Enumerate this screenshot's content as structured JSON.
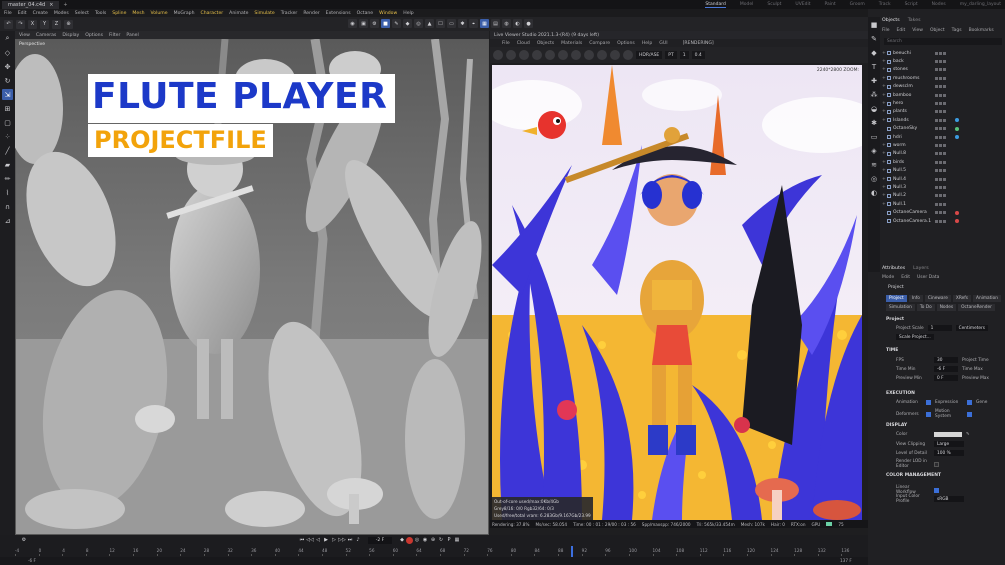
{
  "window": {
    "tab_title": "master_04.c4d",
    "close": "×",
    "add_tab": "+"
  },
  "layouts": [
    "Standard",
    "Model",
    "Sculpt",
    "UVEdit",
    "Paint",
    "Groom",
    "Track",
    "Script",
    "Nodes",
    "my_darling_layout"
  ],
  "menubar": [
    "File",
    "Edit",
    "Create",
    "Modes",
    "Select",
    "Tools",
    "Spline",
    "Mesh",
    "Volume",
    "MoGraph",
    "Character",
    "Animate",
    "Simulate",
    "Tracker",
    "Render",
    "Extensions",
    "Octane",
    "Window",
    "Help"
  ],
  "viewport": {
    "menu": [
      "View",
      "Cameras",
      "Display",
      "Options",
      "Filter",
      "Panel"
    ],
    "label": "Perspective"
  },
  "overlay": {
    "title": "FLUTE PLAYER",
    "subtitle": "PROJECTFILE"
  },
  "live_viewer": {
    "title": "Live Viewer Studio 2021.1.3-(R4) (9 days left)",
    "menu": [
      "File",
      "Cloud",
      "Objects",
      "Materials",
      "Compare",
      "Options",
      "Help",
      "GUI"
    ],
    "status": "[RENDERING]",
    "display_mode": "HDR/ASE",
    "pt_field": "PT",
    "value_field": "1",
    "gamma_field": "0.4",
    "resolution": "2240*2800 ZOOM:",
    "stats": [
      "Out-of-core used/max:0Kb/4Gb",
      "Grey8/16: 0/0      Rgb32/64: 0/3",
      "Used/free/total vram: 6.283Gb/9.167Gb/23.99",
      "Rendering: 37.8%   Ms/sec: 58.054   Time: 00 : 01 : 29/00 : 03 : 56   Spp/maxspp: 746/2000   Tri: 565k/33.454m   Mesh: 107k   Hair: 0   RTX:on   GPU: 75"
    ],
    "status_segments": [
      "Rendering: 37.8%",
      "Ms/sec: 58.054",
      "Time: 00 : 01 : 29/00 : 03 : 56",
      "Spp/maxspp: 746/2000",
      "Tri: 565k/33.454m",
      "Mesh: 107k",
      "Hair: 0",
      "RTX:on",
      "GPU",
      "75"
    ]
  },
  "timeline": {
    "current_frame": "-2 F",
    "ruler_ticks": [
      "-4",
      "0",
      "4",
      "8",
      "12",
      "16",
      "20",
      "24",
      "28",
      "32",
      "36",
      "40",
      "44",
      "48",
      "52",
      "56",
      "60",
      "64",
      "68",
      "72",
      "76",
      "80",
      "84",
      "88",
      "92",
      "96",
      "100",
      "104",
      "108",
      "112",
      "116",
      "120",
      "124",
      "128",
      "132",
      "136"
    ],
    "start": "-6 F",
    "end": "137 F"
  },
  "objects_panel": {
    "tabs": [
      "Objects",
      "Takes"
    ],
    "menu": [
      "File",
      "Edit",
      "View",
      "Object",
      "Tags",
      "Bookmarks"
    ],
    "search_placeholder": "Search",
    "items": [
      {
        "name": "beeuchi",
        "expand": "+"
      },
      {
        "name": "back",
        "expand": "+"
      },
      {
        "name": "stones",
        "expand": "+"
      },
      {
        "name": "mushrooms",
        "expand": "+"
      },
      {
        "name": "dewsclm",
        "expand": "+"
      },
      {
        "name": "bamboo",
        "expand": "+"
      },
      {
        "name": "hero",
        "expand": "+"
      },
      {
        "name": "plants",
        "expand": "+"
      },
      {
        "name": "Islands",
        "expand": "+"
      },
      {
        "name": "OctaneSky",
        "expand": ""
      },
      {
        "name": "hdri",
        "expand": ""
      },
      {
        "name": "worm",
        "expand": "+"
      },
      {
        "name": "Null.8",
        "expand": "+"
      },
      {
        "name": "birds",
        "expand": "+"
      },
      {
        "name": "Null.5",
        "expand": "+"
      },
      {
        "name": "Null.4",
        "expand": "+"
      },
      {
        "name": "Null.3",
        "expand": "+"
      },
      {
        "name": "Null.2",
        "expand": "+"
      },
      {
        "name": "Null.1",
        "expand": "+"
      },
      {
        "name": "OctaneCamera",
        "expand": ""
      },
      {
        "name": "OctaneCamera.1",
        "expand": ""
      }
    ]
  },
  "attributes_panel": {
    "tabs": [
      "Attributes",
      "Layers"
    ],
    "menu": [
      "Mode",
      "Edit",
      "User Data"
    ],
    "title": "Project",
    "subtabs": [
      "Project",
      "Info",
      "Cineware",
      "XRefs",
      "Animation",
      "Simulation",
      "To Do",
      "Nodes",
      "OctaneRender"
    ],
    "section_project": "Project",
    "project_scale_label": "Project Scale",
    "project_scale_value": "1",
    "project_scale_unit": "Centimeters",
    "scale_project_button": "Scale Project...",
    "section_time": "TIME",
    "fps_label": "FPS",
    "fps_value": "30",
    "project_time_label": "Project Time",
    "time_min_label": "Time Min",
    "time_min_value": "-6 F",
    "time_max_label": "Time Max",
    "preview_min_label": "Preview Min",
    "preview_min_value": "0 F",
    "preview_max_label": "Preview Max",
    "section_execution": "EXECUTION",
    "animation_label": "Animation",
    "expression_label": "Expression",
    "generators_label": "Gene",
    "deformers_label": "Deformers",
    "motion_system_label": "Motion System",
    "section_display": "DISPLAY",
    "color_label": "Color",
    "view_clipping_label": "View Clipping",
    "view_clipping_value": "Large",
    "lod_label": "Level of Detail",
    "lod_value": "100 %",
    "render_lod_label": "Render LOD in Editor",
    "section_color_mgmt": "COLOR MANAGEMENT",
    "linear_workflow_label": "Linear Workflow",
    "input_color_profile_label": "Input Color Profile",
    "input_color_profile_value": "sRGB"
  },
  "colors": {
    "accent": "#3b5ea9",
    "title_blue": "#1c39c8",
    "title_orange": "#f2a30b"
  }
}
